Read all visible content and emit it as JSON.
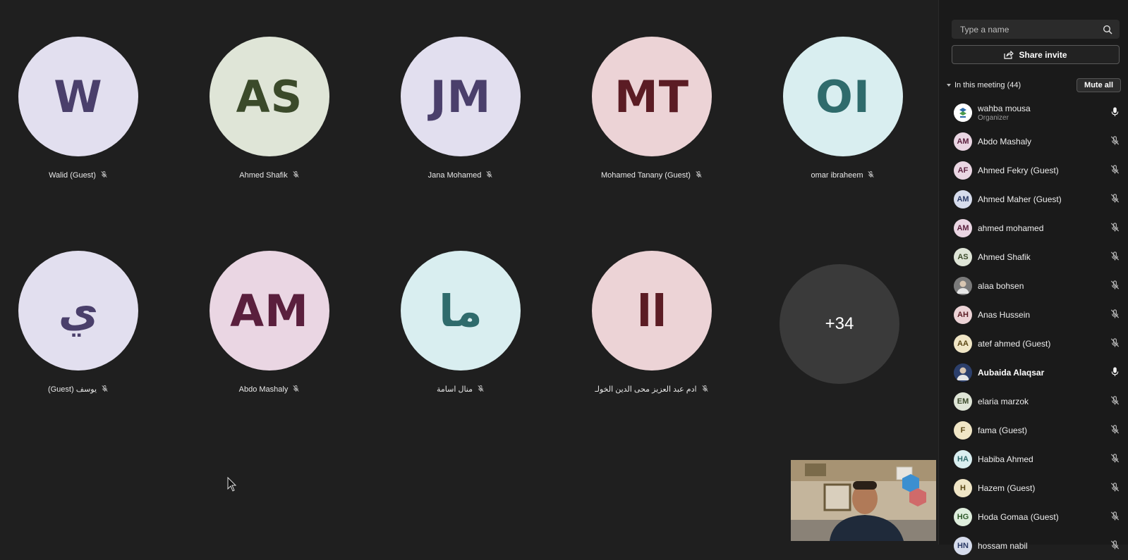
{
  "tiles_row1": [
    {
      "initials": "W",
      "name": "Walid (Guest)",
      "bg": "#e2dfef",
      "fg": "#4a3f6b"
    },
    {
      "initials": "AS",
      "name": "Ahmed Shafik",
      "bg": "#dfe5d7",
      "fg": "#3b4a2a"
    },
    {
      "initials": "JM",
      "name": "Jana Mohamed",
      "bg": "#e2dfef",
      "fg": "#4a3f6b"
    },
    {
      "initials": "MT",
      "name": "Mohamed Tanany (Guest)",
      "bg": "#ecd3d6",
      "fg": "#5b1c24"
    },
    {
      "initials": "OI",
      "name": "omar ibraheem",
      "bg": "#d9eef0",
      "fg": "#2f6b6c"
    }
  ],
  "tiles_row2": [
    {
      "initials": "ي",
      "name": "(Guest) يوسف",
      "bg": "#e2dfef",
      "fg": "#4a3f6b"
    },
    {
      "initials": "AM",
      "name": "Abdo Mashaly",
      "bg": "#ead6e3",
      "fg": "#5a1f3d"
    },
    {
      "initials": "ما",
      "name": "منال اسامة",
      "bg": "#d9eef0",
      "fg": "#2f6b6c"
    },
    {
      "initials": "اا",
      "name": "ادم عبد العزيز محى الدين الخولـ",
      "bg": "#ecd3d6",
      "fg": "#5b1c24"
    }
  ],
  "overflow_count": "+34",
  "panel": {
    "search_placeholder": "Type a name",
    "share_label": "Share invite",
    "section_label": "In this meeting (44)",
    "mute_all_label": "Mute all",
    "participants": [
      {
        "initials": "",
        "name": "wahba mousa",
        "role": "Organizer",
        "bg": "#ffffff",
        "fg": "#333",
        "mic": "on",
        "photo": "logo"
      },
      {
        "initials": "AM",
        "name": "Abdo Mashaly",
        "role": "",
        "bg": "#ead6e3",
        "fg": "#5a1f3d",
        "mic": "off"
      },
      {
        "initials": "AF",
        "name": "Ahmed Fekry (Guest)",
        "role": "",
        "bg": "#ead6e3",
        "fg": "#5a1f3d",
        "mic": "off"
      },
      {
        "initials": "AM",
        "name": "Ahmed Maher (Guest)",
        "role": "",
        "bg": "#d6dcec",
        "fg": "#2a3a66",
        "mic": "off"
      },
      {
        "initials": "AM",
        "name": "ahmed mohamed",
        "role": "",
        "bg": "#ead6e3",
        "fg": "#5a1f3d",
        "mic": "off"
      },
      {
        "initials": "AS",
        "name": "Ahmed Shafik",
        "role": "",
        "bg": "#dfe5d7",
        "fg": "#3b4a2a",
        "mic": "off"
      },
      {
        "initials": "",
        "name": "alaa bohsen",
        "role": "",
        "bg": "#7a7a7a",
        "fg": "#fff",
        "mic": "off",
        "photo": "person"
      },
      {
        "initials": "AH",
        "name": "Anas Hussein",
        "role": "",
        "bg": "#ecd3d6",
        "fg": "#5b1c24",
        "mic": "off"
      },
      {
        "initials": "AA",
        "name": "atef ahmed (Guest)",
        "role": "",
        "bg": "#f0e6c6",
        "fg": "#5a4614",
        "mic": "off"
      },
      {
        "initials": "",
        "name": "Aubaida Alaqsar",
        "role": "",
        "bg": "#2c3f6b",
        "fg": "#fff",
        "mic": "on",
        "photo": "person",
        "bold": true
      },
      {
        "initials": "EM",
        "name": "elaria marzok",
        "role": "",
        "bg": "#dfe5d7",
        "fg": "#3b4a2a",
        "mic": "off"
      },
      {
        "initials": "F",
        "name": "fama (Guest)",
        "role": "",
        "bg": "#f0e6c6",
        "fg": "#5a4614",
        "mic": "off"
      },
      {
        "initials": "HA",
        "name": "Habiba Ahmed",
        "role": "",
        "bg": "#d9eef0",
        "fg": "#2f6b6c",
        "mic": "off"
      },
      {
        "initials": "H",
        "name": "Hazem (Guest)",
        "role": "",
        "bg": "#f0e6c6",
        "fg": "#5a4614",
        "mic": "off"
      },
      {
        "initials": "HG",
        "name": "Hoda Gomaa (Guest)",
        "role": "",
        "bg": "#dfeedd",
        "fg": "#2f5a2a",
        "mic": "off"
      },
      {
        "initials": "HN",
        "name": "hossam nabil",
        "role": "",
        "bg": "#d6dcec",
        "fg": "#2a3a66",
        "mic": "off"
      }
    ]
  },
  "icons": {
    "search": "search-icon",
    "share": "share-icon",
    "mute": "mic-off-icon",
    "unmuted": "mic-icon",
    "chevron": "chevron-down-icon",
    "cursor": "mouse-cursor-icon"
  }
}
